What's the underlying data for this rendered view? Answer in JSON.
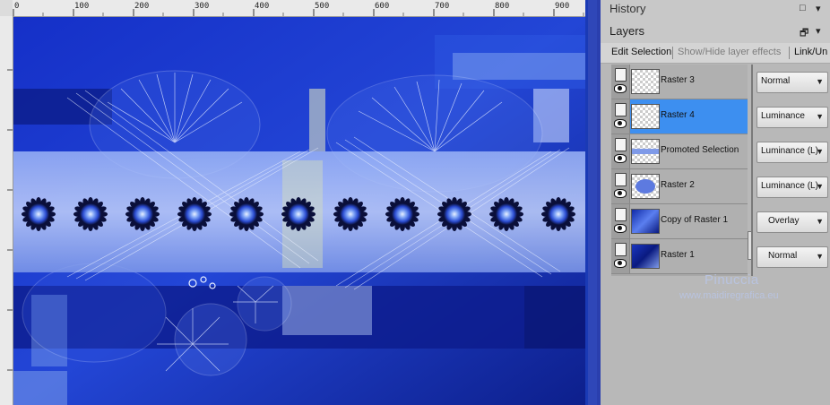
{
  "rulers": {
    "horizontal_ticks": [
      "0",
      "100",
      "200",
      "300",
      "400",
      "500",
      "600",
      "700",
      "800",
      "900"
    ]
  },
  "history_panel": {
    "title": "History",
    "controls": [
      "□",
      "▾"
    ]
  },
  "layers_panel": {
    "title": "Layers",
    "controls": [
      "🗗",
      "▾"
    ],
    "toolbar": {
      "edit_selection": "Edit Selection",
      "show_hide_effects": "Show/Hide layer effects",
      "link_unlink": "Link/Un"
    },
    "layers": [
      {
        "name": "Raster 3",
        "blend_mode": "Normal",
        "selected": false,
        "thumb": "checker"
      },
      {
        "name": "Raster 4",
        "blend_mode": "Luminance",
        "selected": true,
        "thumb": "checker"
      },
      {
        "name": "Promoted Selection",
        "blend_mode": "Luminance (L)",
        "selected": false,
        "thumb": "checker-band"
      },
      {
        "name": "Raster 2",
        "blend_mode": "Luminance (L)",
        "selected": false,
        "thumb": "flowers"
      },
      {
        "name": "Copy of Raster 1",
        "blend_mode": "Overlay",
        "selected": false,
        "thumb": "blue"
      },
      {
        "name": "Raster 1",
        "blend_mode": "Normal",
        "selected": false,
        "thumb": "blue"
      }
    ]
  },
  "watermark": {
    "name": "Pinuccia",
    "url": "www.maidiregrafica.eu"
  },
  "colors": {
    "selected_layer": "#3d8ff0",
    "canvas_blue": "#1a2b9e",
    "panel_gray": "#b8b8b8"
  }
}
